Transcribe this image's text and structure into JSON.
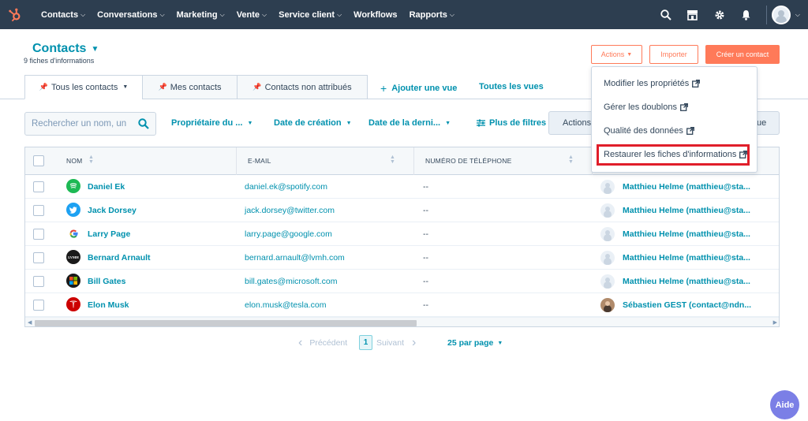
{
  "nav": {
    "items": [
      {
        "label": "Contacts",
        "has_menu": true
      },
      {
        "label": "Conversations",
        "has_menu": true
      },
      {
        "label": "Marketing",
        "has_menu": true
      },
      {
        "label": "Vente",
        "has_menu": true
      },
      {
        "label": "Service client",
        "has_menu": true
      },
      {
        "label": "Workflows",
        "has_menu": false
      },
      {
        "label": "Rapports",
        "has_menu": true
      }
    ],
    "icons": [
      "search-icon",
      "marketplace-icon",
      "gear-icon",
      "bell-icon",
      "avatar-icon"
    ]
  },
  "header": {
    "title": "Contacts",
    "subtitle": "9 fiches d'informations",
    "actions_label": "Actions",
    "import_label": "Importer",
    "create_label": "Créer un contact"
  },
  "tabs": [
    {
      "label": "Tous les contacts",
      "active": true
    },
    {
      "label": "Mes contacts",
      "active": false
    },
    {
      "label": "Contacts non attribués",
      "active": false
    }
  ],
  "add_view_label": "Ajouter une vue",
  "all_views_label": "Toutes les vues",
  "filters": {
    "search_placeholder": "Rechercher un nom, un",
    "owner": "Propriétaire du ...",
    "created": "Date de création",
    "last": "Date de la derni...",
    "more": "Plus de filtres",
    "table_actions": "Actions",
    "save_tail": "ue"
  },
  "table": {
    "headers": {
      "name": "NOM",
      "email": "E-MAIL",
      "phone": "NUMÉRO DE TÉLÉPHONE"
    },
    "rows": [
      {
        "name": "Daniel Ek",
        "email": "daniel.ek@spotify.com",
        "phone": "--",
        "owner": "Matthieu Helme (matthieu@sta...",
        "logo": "spotify-logo-icon",
        "color": "#1db954",
        "glyph": "≋"
      },
      {
        "name": "Jack Dorsey",
        "email": "jack.dorsey@twitter.com",
        "phone": "--",
        "owner": "Matthieu Helme (matthieu@sta...",
        "logo": "twitter-logo-icon",
        "color": "#1da1f2",
        "glyph": "✦"
      },
      {
        "name": "Larry Page",
        "email": "larry.page@google.com",
        "phone": "--",
        "owner": "Matthieu Helme (matthieu@sta...",
        "logo": "google-logo-icon",
        "color": "#ffffff",
        "glyph": "G"
      },
      {
        "name": "Bernard Arnault",
        "email": "bernard.arnault@lvmh.com",
        "phone": "--",
        "owner": "Matthieu Helme (matthieu@sta...",
        "logo": "lvmh-logo-icon",
        "color": "#1a1a1a",
        "glyph": "LVMH"
      },
      {
        "name": "Bill Gates",
        "email": "bill.gates@microsoft.com",
        "phone": "--",
        "owner": "Matthieu Helme (matthieu@sta...",
        "logo": "microsoft-logo-icon",
        "color": "#1a1a1a",
        "glyph": "▦"
      },
      {
        "name": "Elon Musk",
        "email": "elon.musk@tesla.com",
        "phone": "--",
        "owner": "Sébastien GEST (contact@ndn...",
        "logo": "tesla-logo-icon",
        "color": "#cc0000",
        "glyph": "T"
      }
    ]
  },
  "pagination": {
    "prev": "Précédent",
    "current": "1",
    "next": "Suivant",
    "per_page": "25 par page"
  },
  "dropdown": {
    "items": [
      "Modifier les propriétés",
      "Gérer les doublons",
      "Qualité des données",
      "Restaurer les fiches d'informations"
    ]
  },
  "help_label": "Aide",
  "colors": {
    "nav_bg": "#2d3e50",
    "accent": "#0091ae",
    "orange": "#ff7a59",
    "highlight": "#e01e2a"
  }
}
